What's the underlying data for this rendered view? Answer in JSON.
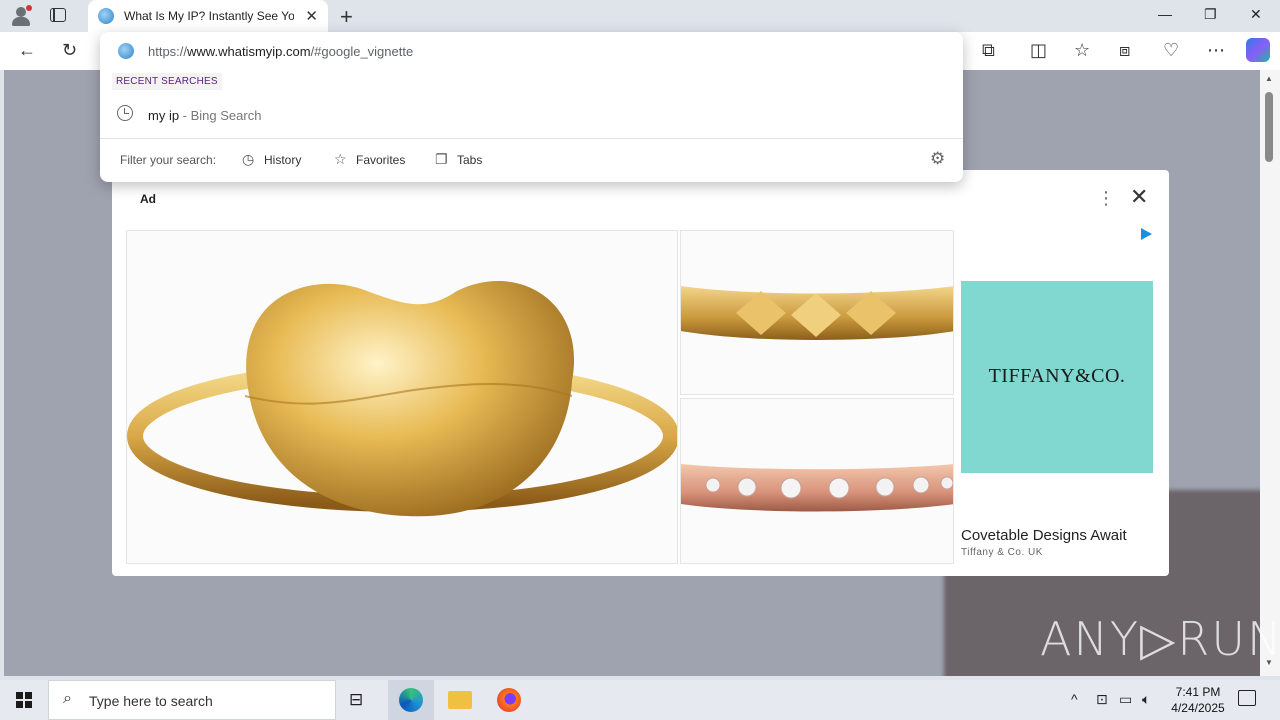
{
  "browser": {
    "tab_title": "What Is My IP? Instantly See Your",
    "tab_close": "✕",
    "new_tab": "+",
    "window_controls": {
      "minimize": "—",
      "restore": "❐",
      "close": "✕"
    },
    "toolbar": {
      "back": "←",
      "reload": "↻"
    },
    "toolbar_right_icons": [
      "extensions-icon",
      "split-screen-icon",
      "favorites-icon",
      "collections-icon",
      "performance-icon",
      "more-icon",
      "copilot-icon"
    ]
  },
  "omnibox": {
    "url_prefix": "https://",
    "url_domain": "www.whatismyip.com",
    "url_rest": "/#google_vignette",
    "recent_label": "RECENT SEARCHES",
    "suggestion_query": "my ip",
    "suggestion_source": " - Bing Search",
    "filter_label": "Filter your search:",
    "filters": [
      {
        "label": "History",
        "icon": "history-icon"
      },
      {
        "label": "Favorites",
        "icon": "star-icon"
      },
      {
        "label": "Tabs",
        "icon": "tabs-icon"
      }
    ]
  },
  "ad": {
    "label": "Ad",
    "more_icon": "⋮",
    "close_icon": "✕",
    "brand_logo": "TIFFANY&CO.",
    "headline": "Covetable Designs Await",
    "advertiser": "Tiffany & Co. UK",
    "brand_color": "#81d8d0"
  },
  "watermark": "ANY▷RUN",
  "taskbar": {
    "search_placeholder": "Type here to search",
    "time": "7:41 PM",
    "date": "4/24/2025"
  }
}
